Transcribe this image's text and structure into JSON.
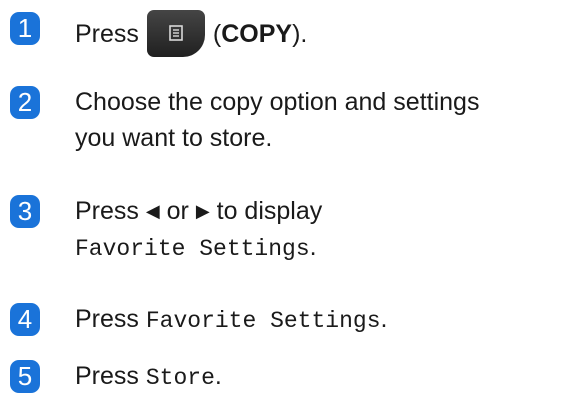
{
  "steps": [
    {
      "number": "1",
      "text_press": "Press",
      "text_paren_open": "(",
      "button_label": "COPY",
      "text_paren_close": ")."
    },
    {
      "number": "2",
      "line1": "Choose the copy option and settings",
      "line2": "you want to store."
    },
    {
      "number": "3",
      "text_press": "Press",
      "left_arrow": "◀",
      "text_or": "or",
      "right_arrow": "▶",
      "text_display": "to display",
      "line2_mono": "Favorite Settings",
      "line2_end": "."
    },
    {
      "number": "4",
      "text_press": "Press",
      "mono": "Favorite Settings",
      "end": "."
    },
    {
      "number": "5",
      "text_press": "Press",
      "mono": "Store",
      "end": "."
    }
  ],
  "icons": {
    "copy_button": "copy-document-icon"
  },
  "colors": {
    "step_badge": "#1a73d9",
    "button_bg": "#2b2b2b"
  }
}
